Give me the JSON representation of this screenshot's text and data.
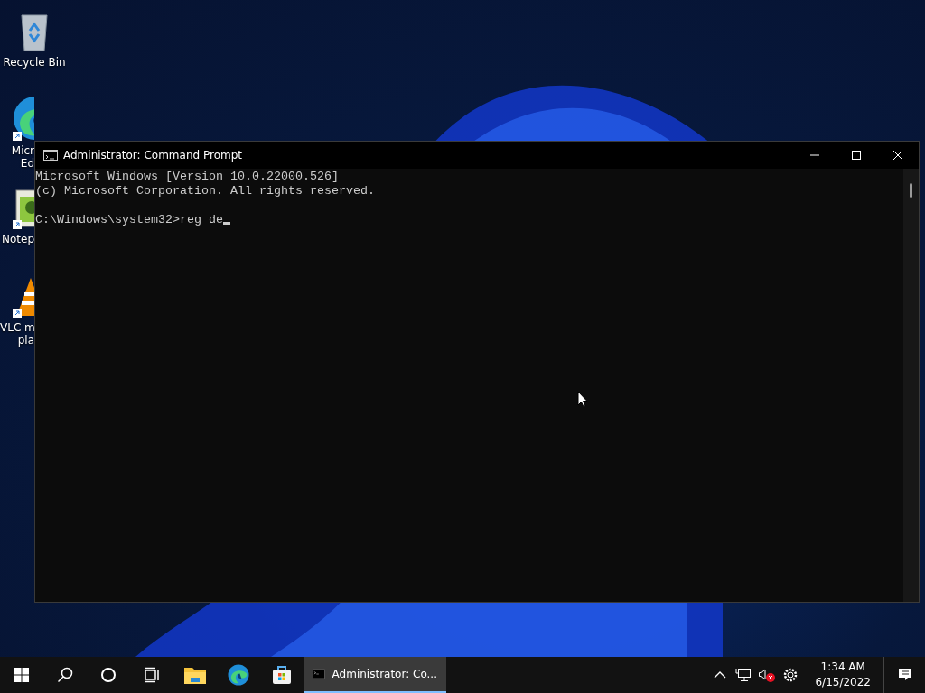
{
  "desktop_icons": [
    {
      "kind": "recycle-bin",
      "label_lines": [
        "Recycle Bin"
      ],
      "cut": false
    },
    {
      "kind": "browser",
      "label_lines": [
        "Micr",
        "Ed"
      ],
      "cut": true
    },
    {
      "kind": "notepad",
      "label_lines": [
        "Notep"
      ],
      "cut": true
    },
    {
      "kind": "media-player",
      "label_lines": [
        "VLC m",
        "pla"
      ],
      "cut": true
    }
  ],
  "window": {
    "title": "Administrator: Command Prompt",
    "console_lines": [
      "Microsoft Windows [Version 10.0.22000.526]",
      "(c) Microsoft Corporation. All rights reserved."
    ],
    "prompt": "C:\\Windows\\system32>",
    "input": "reg de"
  },
  "taskbar": {
    "buttons": [
      {
        "kind": "start"
      },
      {
        "kind": "search"
      },
      {
        "kind": "cortana"
      },
      {
        "kind": "task-view"
      },
      {
        "kind": "folder"
      },
      {
        "kind": "browser"
      },
      {
        "kind": "store"
      }
    ],
    "apps": [
      {
        "label": "Administrator: Co...",
        "selected": true
      }
    ],
    "tray": [
      {
        "kind": "chevron"
      },
      {
        "kind": "network"
      },
      {
        "kind": "volume-muted"
      },
      {
        "kind": "settings"
      }
    ],
    "time": "1:34 AM",
    "date": "6/15/2022"
  }
}
